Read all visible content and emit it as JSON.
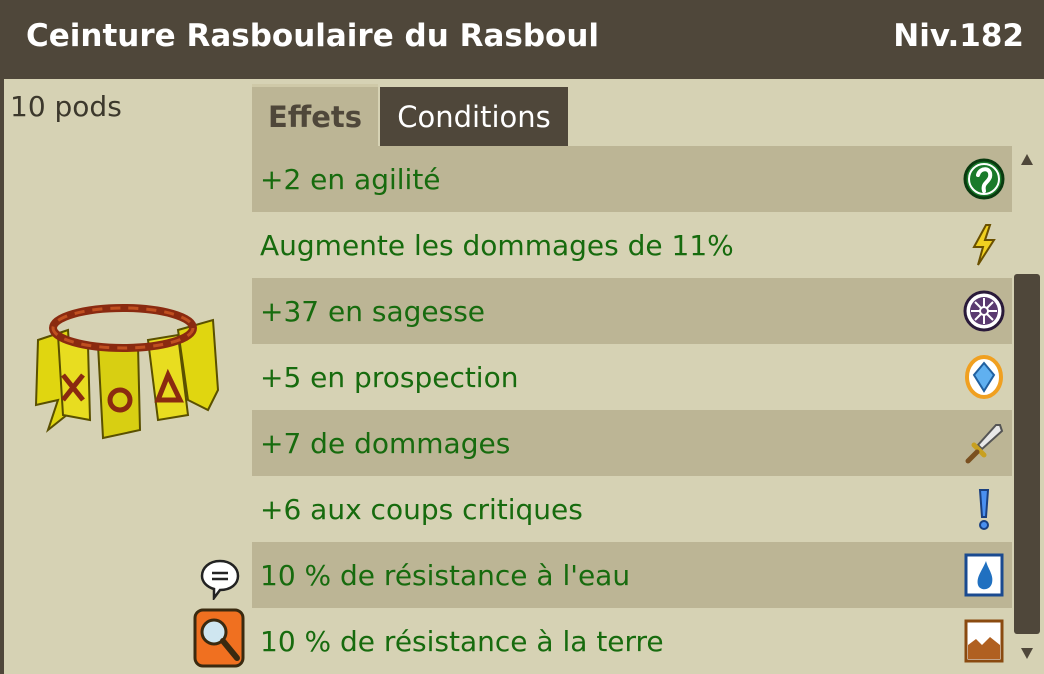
{
  "item": {
    "name": "Ceinture Rasboulaire du Rasboul",
    "level": "Niv.182",
    "weight": "10 pods"
  },
  "tabs": [
    {
      "label": "Effets",
      "active": true
    },
    {
      "label": "Conditions",
      "active": false
    }
  ],
  "effects": [
    {
      "text": "+2 en agilité",
      "icon": "agility-icon"
    },
    {
      "text": "Augmente les dommages de 11%",
      "icon": "power-icon"
    },
    {
      "text": "+37 en sagesse",
      "icon": "wisdom-icon"
    },
    {
      "text": "+5 en prospection",
      "icon": "prospecting-icon"
    },
    {
      "text": "+7 de dommages",
      "icon": "damage-icon"
    },
    {
      "text": "+6 aux coups critiques",
      "icon": "critical-icon"
    },
    {
      "text": "10 % de résistance à l'eau",
      "icon": "water-resistance-icon"
    },
    {
      "text": "10 % de résistance à la terre",
      "icon": "earth-resistance-icon"
    }
  ],
  "colors": {
    "header_bg": "#4f473a",
    "panel_bg": "#d6d2b4",
    "row_dark": "#bcb595",
    "effect_text": "#176b0e"
  }
}
